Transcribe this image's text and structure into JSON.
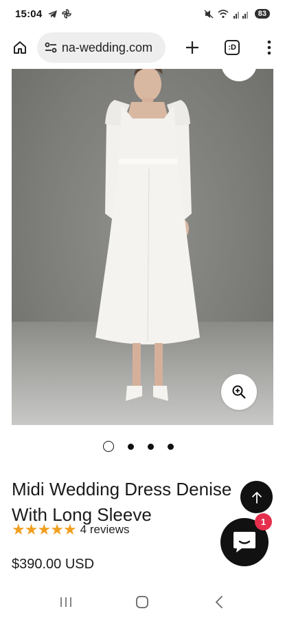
{
  "status_bar": {
    "time": "15:04",
    "battery": "83",
    "icons": [
      "telegram-icon",
      "pinwheel-icon",
      "mute-icon",
      "wifi-icon",
      "signal-icon"
    ]
  },
  "browser": {
    "url": "na-wedding.com",
    "tabs_label": ":D",
    "icons": [
      "home-icon",
      "site-settings-icon",
      "new-tab-icon",
      "tabs-icon",
      "menu-icon"
    ]
  },
  "product": {
    "title": "Midi Wedding Dress Denise With Long Sleeve",
    "rating_stars": 5,
    "reviews_label": "4 reviews",
    "price": "$390.00 USD"
  },
  "carousel": {
    "total_slides": 4,
    "active_index": 0
  },
  "chat": {
    "badge_count": "1"
  },
  "colors": {
    "star": "#f0a020",
    "badge": "#e62f4c",
    "button_dark": "#111111"
  }
}
